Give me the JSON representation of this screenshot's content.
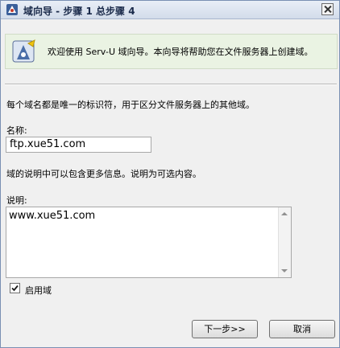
{
  "window": {
    "title": "域向导 - 步骤 1 总步骤 4"
  },
  "banner": {
    "text": "欢迎使用 Serv-U 域向导。本向导将帮助您在文件服务器上创建域。"
  },
  "form": {
    "intro": "每个域名都是唯一的标识符，用于区分文件服务器上的其他域。",
    "name_label": "名称:",
    "name_value": "ftp.xue51.com",
    "desc_info": "域的说明中可以包含更多信息。说明为可选内容。",
    "desc_label": "说明:",
    "desc_value": "www.xue51.com",
    "enable_label": "启用域",
    "enable_checked": true
  },
  "buttons": {
    "next": "下一步>>",
    "cancel": "取消"
  },
  "icons": {
    "title": "wizard-icon",
    "close": "close-icon",
    "banner": "wizard-icon",
    "checkmark": "checkmark-icon"
  }
}
